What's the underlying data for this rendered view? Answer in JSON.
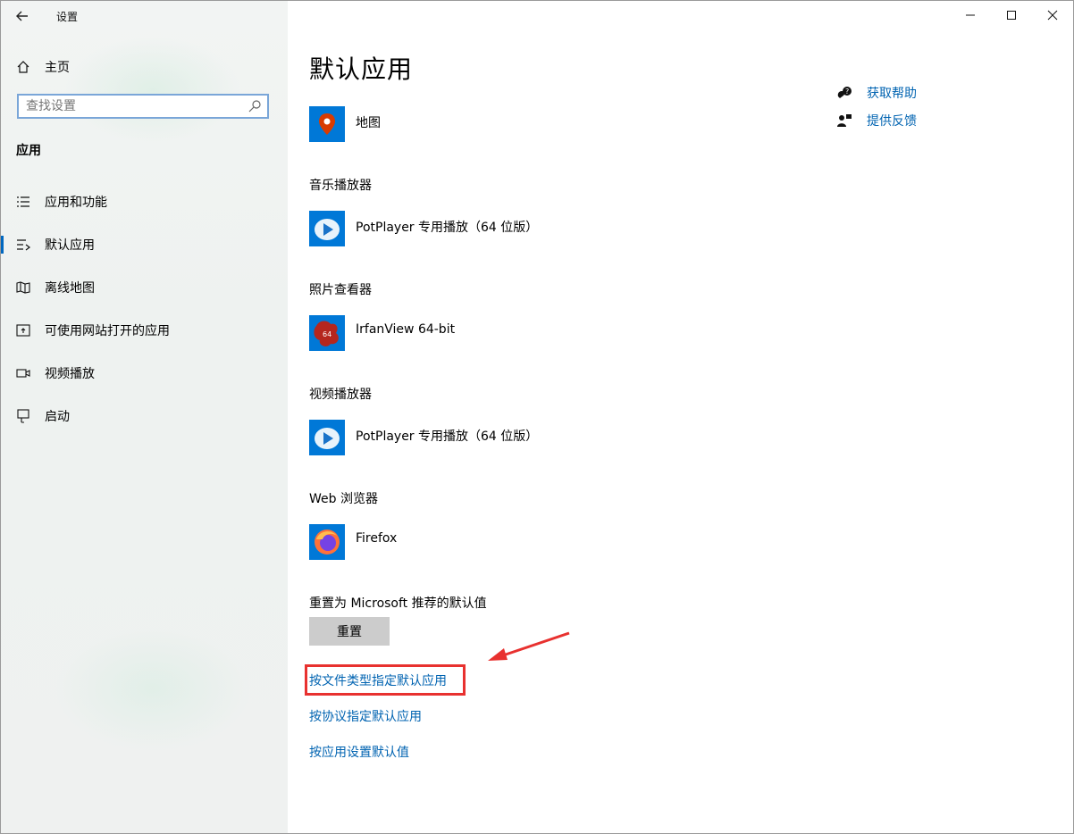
{
  "window": {
    "title": "设置"
  },
  "sidebar": {
    "home_label": "主页",
    "search": {
      "placeholder": "查找设置"
    },
    "section_label": "应用",
    "items": [
      {
        "label": "应用和功能",
        "icon": "list-icon"
      },
      {
        "label": "默认应用",
        "icon": "default-apps-icon",
        "active": true
      },
      {
        "label": "离线地图",
        "icon": "map-icon"
      },
      {
        "label": "可使用网站打开的应用",
        "icon": "open-web-icon"
      },
      {
        "label": "视频播放",
        "icon": "video-icon"
      },
      {
        "label": "启动",
        "icon": "startup-icon"
      }
    ]
  },
  "main": {
    "title": "默认应用",
    "side_links": [
      {
        "label": "获取帮助",
        "icon": "help-icon"
      },
      {
        "label": "提供反馈",
        "icon": "feedback-icon"
      }
    ],
    "map_app": {
      "name": "地图"
    },
    "groups": [
      {
        "label": "音乐播放器",
        "app": "PotPlayer 专用播放（64 位版）"
      },
      {
        "label": "照片查看器",
        "app": "IrfanView 64-bit"
      },
      {
        "label": "视频播放器",
        "app": "PotPlayer 专用播放（64 位版）"
      },
      {
        "label": "Web 浏览器",
        "app": "Firefox"
      }
    ],
    "irfanview_badge": "64",
    "reset": {
      "label": "重置为 Microsoft 推荐的默认值",
      "button": "重置"
    },
    "links": [
      "按文件类型指定默认应用",
      "按协议指定默认应用",
      "按应用设置默认值"
    ]
  },
  "colors": {
    "accent": "#0078d7",
    "link": "#0063b1",
    "annotation": "#e8312f"
  }
}
